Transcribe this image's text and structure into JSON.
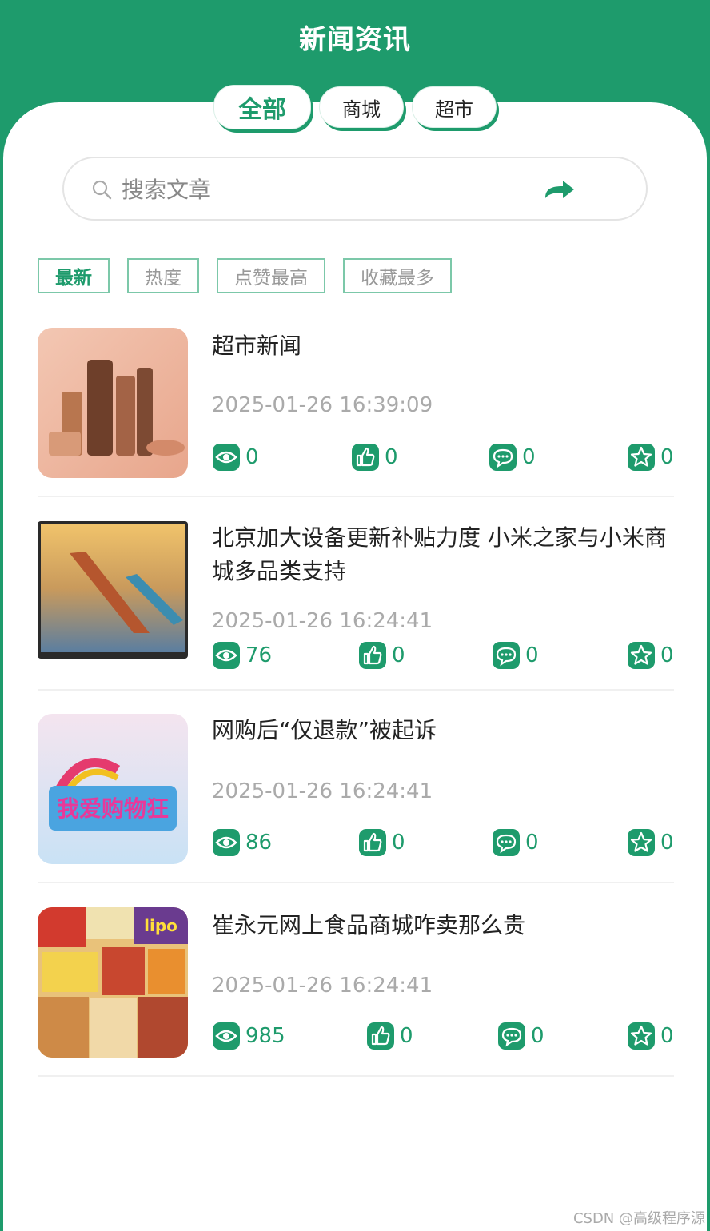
{
  "header": {
    "title": "新闻资讯"
  },
  "tabs": [
    {
      "label": "全部"
    },
    {
      "label": "商城"
    },
    {
      "label": "超市"
    }
  ],
  "search": {
    "placeholder": "搜索文章"
  },
  "sorts": [
    {
      "label": "最新"
    },
    {
      "label": "热度"
    },
    {
      "label": "点赞最高"
    },
    {
      "label": "收藏最多"
    }
  ],
  "news": [
    {
      "title": "超市新闻",
      "date": "2025-01-26 16:39:09",
      "views": "0",
      "likes": "0",
      "comments": "0",
      "favorites": "0"
    },
    {
      "title": "北京加大设备更新补贴力度 小米之家与小米商城多品类支持",
      "date": "2025-01-26 16:24:41",
      "views": "76",
      "likes": "0",
      "comments": "0",
      "favorites": "0"
    },
    {
      "title": "网购后“仅退款”被起诉",
      "date": "2025-01-26 16:24:41",
      "views": "86",
      "likes": "0",
      "comments": "0",
      "favorites": "0"
    },
    {
      "title": "崔永元网上食品商城咋卖那么贵",
      "date": "2025-01-26 16:24:41",
      "views": "985",
      "likes": "0",
      "comments": "0",
      "favorites": "0"
    }
  ],
  "thumb_texts": {
    "img3": "我爱购物狂",
    "img4": "lipo"
  },
  "colors": {
    "primary": "#1e9b6c",
    "muted": "#aaaaaa"
  },
  "watermark": "CSDN @高级程序源"
}
